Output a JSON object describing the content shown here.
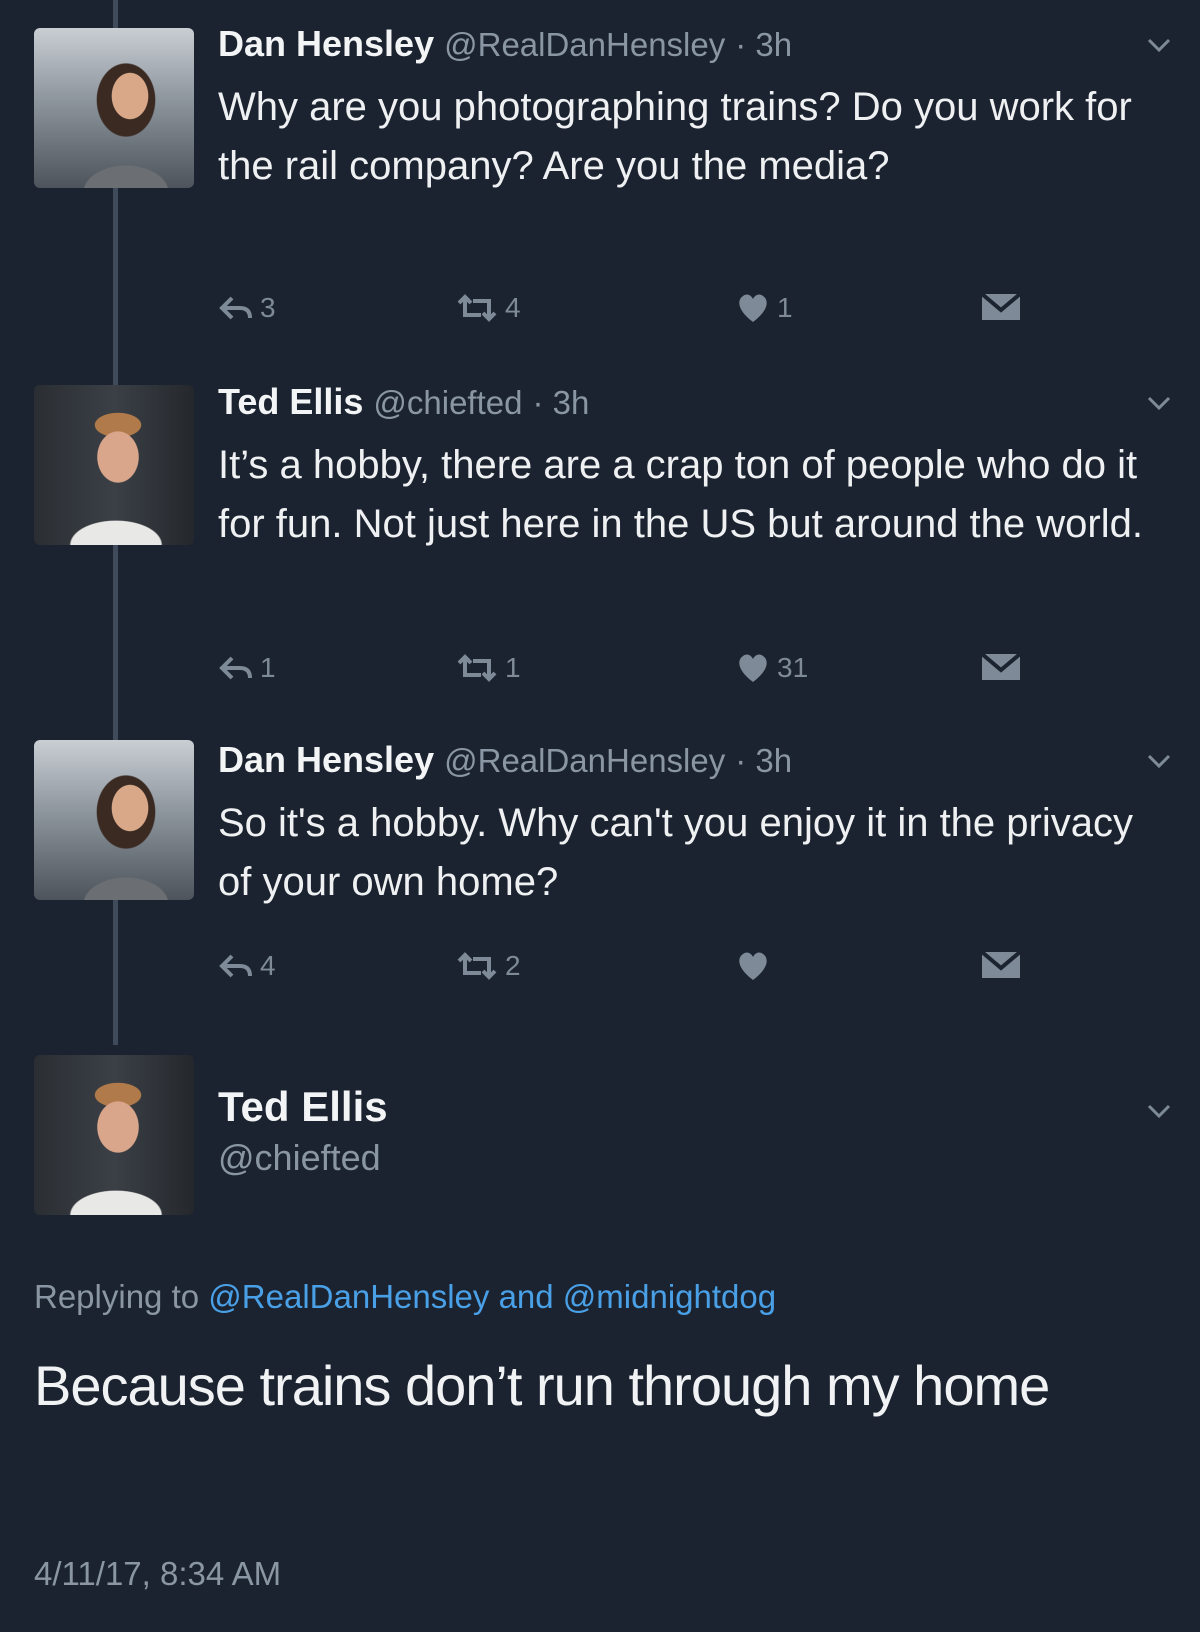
{
  "tweets": [
    {
      "name": "Dan Hensley",
      "handle": "@RealDanHensley",
      "time": "· 3h",
      "text": "Why are you photographing trains? Do you work for the rail company? Are you the media?",
      "replies": "3",
      "retweets": "4",
      "likes": "1"
    },
    {
      "name": "Ted Ellis",
      "handle": "@chiefted",
      "time": "· 3h",
      "text": "It’s a hobby, there are a crap ton of people who do it for fun. Not just here in the US but around the world.",
      "replies": "1",
      "retweets": "1",
      "likes": "31"
    },
    {
      "name": "Dan Hensley",
      "handle": "@RealDanHensley",
      "time": "· 3h",
      "text": "So it's a hobby. Why can't you enjoy it in the privacy of your own home?",
      "replies": "4",
      "retweets": "2",
      "likes": ""
    }
  ],
  "main_tweet": {
    "name": "Ted Ellis",
    "handle": "@chiefted",
    "replying_prefix": "Replying to",
    "replying_to": "@RealDanHensley and @midnightdog",
    "text": "Because trains don’t run through my home",
    "timestamp": "4/11/17, 8:34 AM"
  },
  "icons": {
    "reply": "reply-icon",
    "retweet": "retweet-icon",
    "like": "heart-icon",
    "dm": "envelope-icon",
    "menu": "chevron-down-icon"
  },
  "colors": {
    "background": "#1b2330",
    "link": "#4aa0e6",
    "muted": "#8a96a3"
  }
}
